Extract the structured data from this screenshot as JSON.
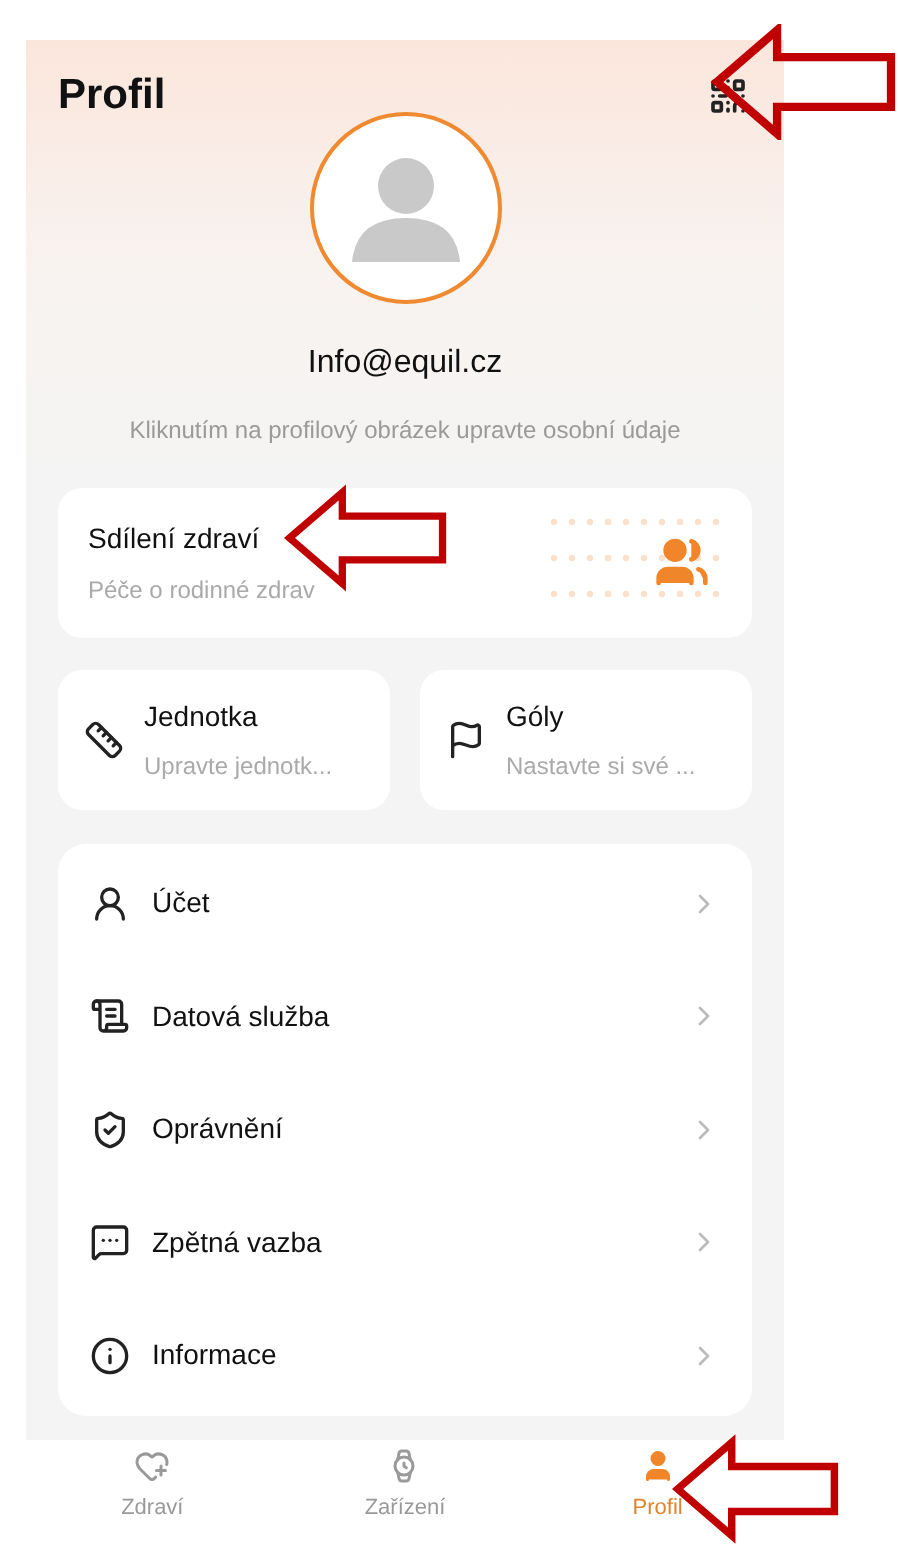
{
  "header": {
    "title": "Profil"
  },
  "profile": {
    "email": "Info@equil.cz",
    "hint": "Kliknutím na profilový obrázek upravte osobní údaje"
  },
  "sharing_card": {
    "title": "Sdílení zdraví",
    "subtitle": "Péče o rodinné zdrav"
  },
  "tiles": [
    {
      "kind": "unit",
      "title": "Jednotka",
      "subtitle": "Upravte jednotk..."
    },
    {
      "kind": "goals",
      "title": "Góly",
      "subtitle": "Nastavte si své ..."
    }
  ],
  "menu": [
    {
      "kind": "account",
      "label": "Účet"
    },
    {
      "kind": "data",
      "label": "Datová služba"
    },
    {
      "kind": "permission",
      "label": "Oprávnění"
    },
    {
      "kind": "feedback",
      "label": "Zpětná vazba"
    },
    {
      "kind": "info",
      "label": "Informace"
    }
  ],
  "nav": [
    {
      "kind": "health",
      "label": "Zdraví",
      "selected": false
    },
    {
      "kind": "device",
      "label": "Zařízení",
      "selected": false
    },
    {
      "kind": "profile",
      "label": "Profil",
      "selected": true
    }
  ]
}
